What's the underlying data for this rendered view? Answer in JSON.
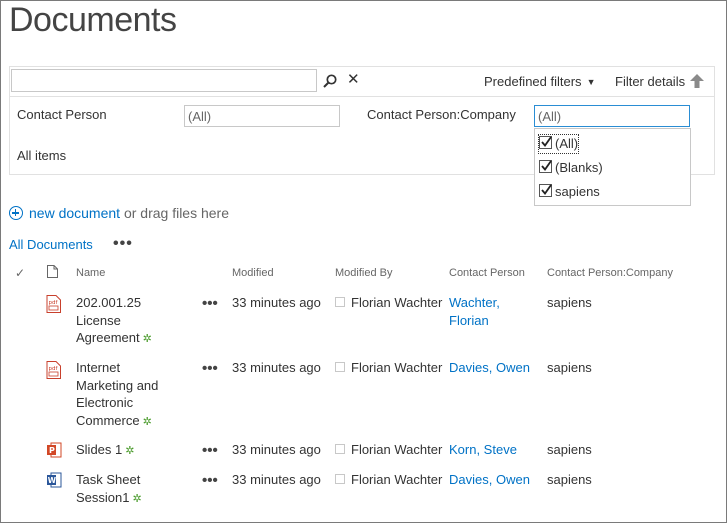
{
  "page": {
    "title": "Documents"
  },
  "filter_bar": {
    "search_value": "",
    "predefined_filters_label": "Predefined filters",
    "filter_details_label": "Filter details",
    "filters": [
      {
        "label": "Contact Person",
        "value": "(All)"
      },
      {
        "label": "Contact Person:Company",
        "value": "(All)"
      }
    ],
    "dropdown_options": [
      {
        "label": "(All)",
        "checked": true
      },
      {
        "label": "(Blanks)",
        "checked": true
      },
      {
        "label": "sapiens",
        "checked": true
      }
    ],
    "view_label": "All items"
  },
  "toolbar": {
    "new_document_label": "new document",
    "drag_hint": "or drag files here",
    "view_name": "All Documents",
    "more_label": "•••"
  },
  "columns": [
    "Name",
    "Modified",
    "Modified By",
    "Contact Person",
    "Contact Person:Company"
  ],
  "rows": [
    {
      "icon": "pdf-file-icon",
      "name_lines": [
        "202.001.25",
        "License",
        "Agreement"
      ],
      "modified": "33 minutes ago",
      "modified_by": "Florian Wachter",
      "contact_lines": [
        "Wachter,",
        "Florian"
      ],
      "company": "sapiens"
    },
    {
      "icon": "pdf-file-icon",
      "name_lines": [
        "Internet",
        "Marketing and",
        "Electronic",
        "Commerce"
      ],
      "modified": "33 minutes ago",
      "modified_by": "Florian Wachter",
      "contact_lines": [
        "Davies, Owen"
      ],
      "company": "sapiens"
    },
    {
      "icon": "powerpoint-file-icon",
      "name_lines": [
        "Slides 1"
      ],
      "modified": "33 minutes ago",
      "modified_by": "Florian Wachter",
      "contact_lines": [
        "Korn, Steve"
      ],
      "company": "sapiens"
    },
    {
      "icon": "word-file-icon",
      "name_lines": [
        "Task Sheet",
        "Session1"
      ],
      "modified": "33 minutes ago",
      "modified_by": "Florian Wachter",
      "contact_lines": [
        "Davies, Owen"
      ],
      "company": "sapiens"
    }
  ],
  "colors": {
    "accent": "#0072c6",
    "new_badge": "#4c9c2e",
    "pdf": "#c8402c",
    "powerpoint": "#d24726",
    "word": "#2b579a"
  }
}
